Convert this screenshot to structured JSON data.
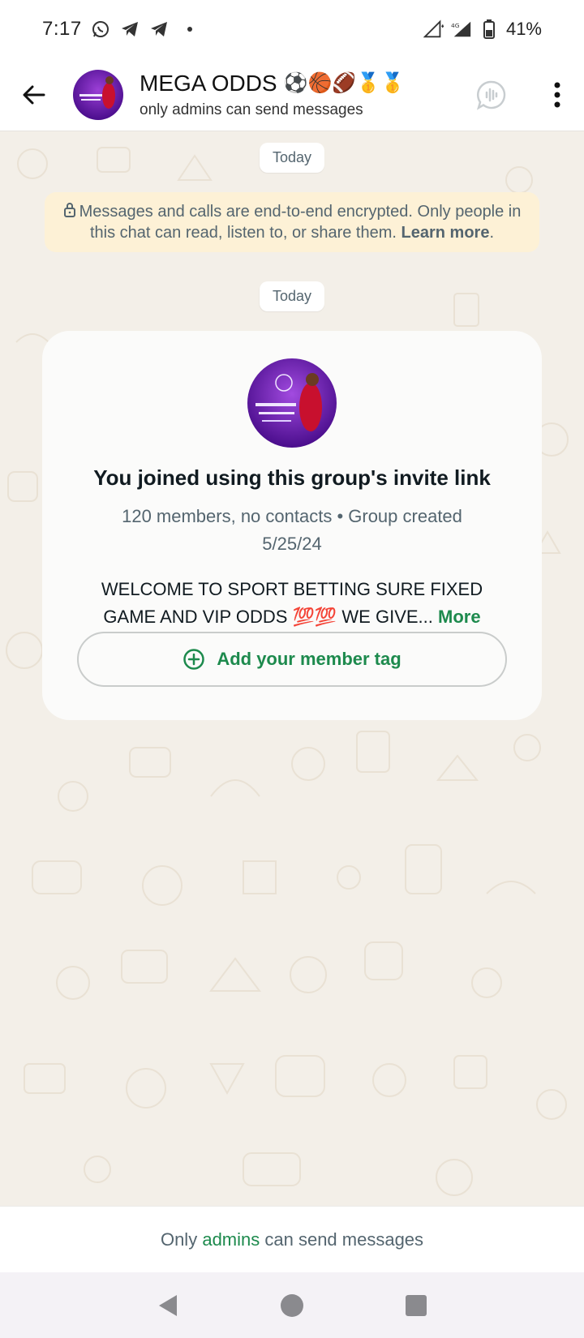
{
  "status_bar": {
    "time": "7:17",
    "battery": "41%",
    "network": "4G"
  },
  "header": {
    "title": "MEGA ODDS",
    "title_emojis": "⚽🏀🏈🥇🥇",
    "subtitle": "only admins can send messages"
  },
  "chat": {
    "date_1": "Today",
    "encryption_notice": "Messages and calls are end-to-end encrypted. Only people in this chat can read, listen to, or share them.",
    "learn_more": "Learn more",
    "date_2": "Today",
    "card": {
      "title": "You joined using this group's invite link",
      "meta": "120 members, no contacts • Group created 5/25/24",
      "description": "WELCOME TO SPORT BETTING SURE FIXED GAME AND VIP ODDS 💯💯 WE GIVE...",
      "more_label": "More",
      "member_tag_button": "Add your member tag"
    }
  },
  "footer": {
    "prefix": "Only",
    "link": "admins",
    "suffix": "can send messages"
  },
  "colors": {
    "accent_green": "#1d8a4d",
    "chat_bg": "#f3efe8",
    "encrypt_bg": "#fdf1d6"
  },
  "icons": {
    "status": [
      "whatsapp-icon",
      "telegram-icon",
      "telegram-icon",
      "signal-icon",
      "battery-icon"
    ],
    "header": [
      "back-arrow-icon",
      "voice-chat-icon",
      "more-vert-icon"
    ],
    "nav": [
      "nav-back-icon",
      "nav-home-icon",
      "nav-recents-icon"
    ]
  }
}
